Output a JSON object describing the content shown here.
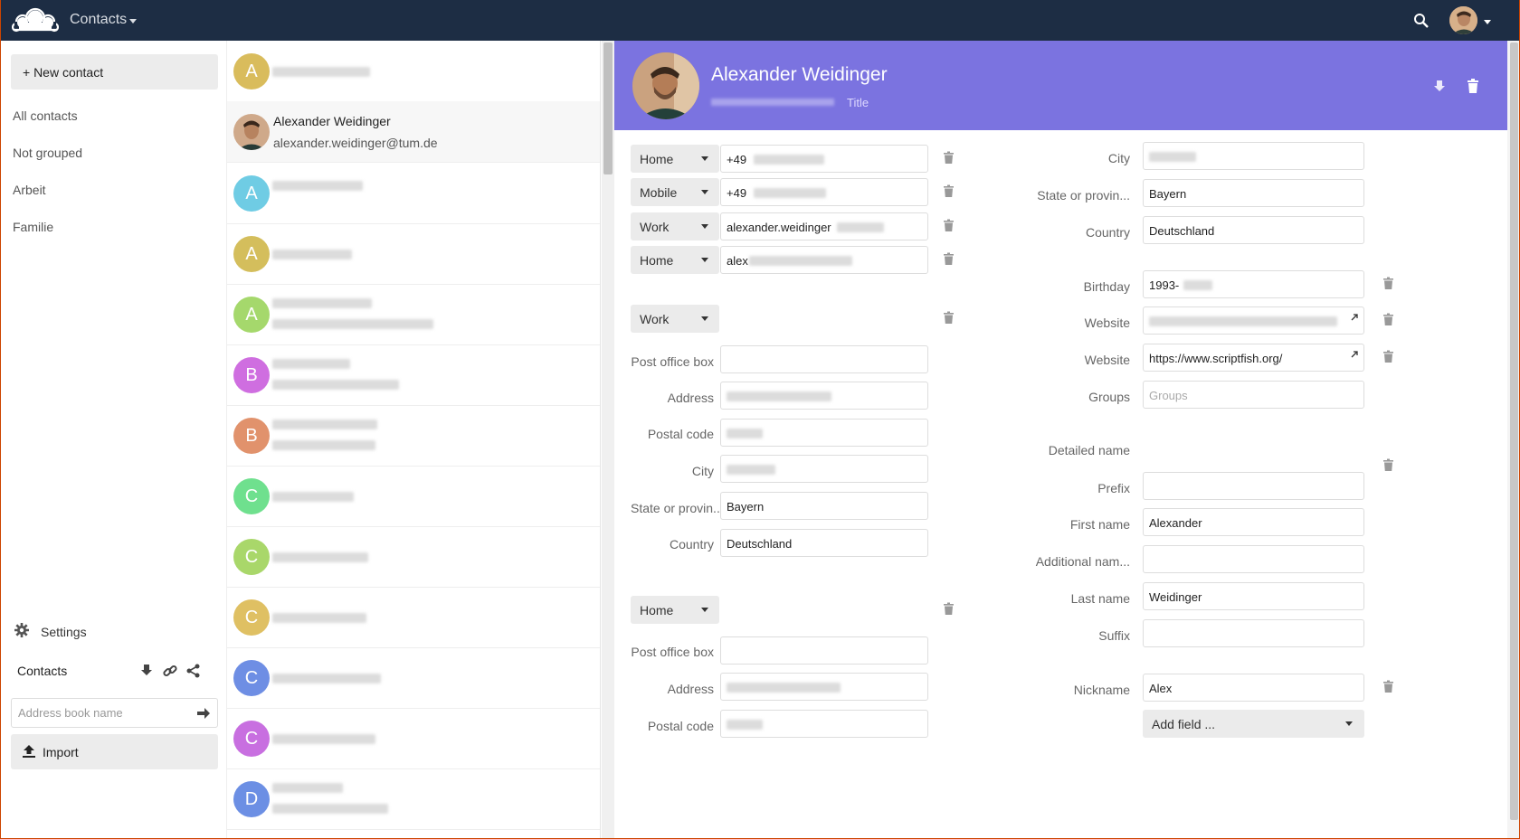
{
  "header": {
    "app_name": "Contacts",
    "search_icon": "search-icon",
    "logo": "owncloud-logo"
  },
  "sidebar": {
    "new_contact": "+ New contact",
    "nav": [
      "All contacts",
      "Not grouped",
      "Arbeit",
      "Familie"
    ],
    "settings": "Settings",
    "addressbook_label": "Contacts",
    "addressbook_placeholder": "Address book name",
    "import": "Import"
  },
  "list": {
    "rows": [
      {
        "initial": "A",
        "color": "#d9bc5c"
      },
      {
        "name": "Alexander Weidinger",
        "email": "alexander.weidinger@tum.de",
        "selected": true
      },
      {
        "initial": "A",
        "color": "#6fcce4"
      },
      {
        "initial": "A",
        "color": "#d4be5c"
      },
      {
        "initial": "A",
        "color": "#a5d86c"
      },
      {
        "initial": "B",
        "color": "#cf6ee0"
      },
      {
        "initial": "B",
        "color": "#e1926c"
      },
      {
        "initial": "C",
        "color": "#6fe08e"
      },
      {
        "initial": "C",
        "color": "#a9d76a"
      },
      {
        "initial": "C",
        "color": "#dfc063"
      },
      {
        "initial": "C",
        "color": "#6e8ee4"
      },
      {
        "initial": "C",
        "color": "#c86fe0"
      },
      {
        "initial": "D",
        "color": "#6c8fe4"
      }
    ]
  },
  "detail": {
    "name": "Alexander Weidinger",
    "title_placeholder": "Title",
    "header_color": "#7b73e0",
    "phones": [
      {
        "type": "Home",
        "value": "+49"
      },
      {
        "type": "Mobile",
        "value": "+49"
      },
      {
        "type": "Work",
        "value": "alexander.weidinger"
      },
      {
        "type": "Home",
        "value": "alex"
      }
    ],
    "address1": {
      "type": "Work",
      "labels": [
        "Post office box",
        "Address",
        "Postal code",
        "City",
        "State or provin...",
        "Country"
      ],
      "state": "Bayern",
      "country": "Deutschland"
    },
    "address2": {
      "type": "Home",
      "labels": [
        "Post office box",
        "Address",
        "Postal code"
      ]
    },
    "right": {
      "labels": {
        "city": "City",
        "state": "State or provin...",
        "country": "Country",
        "birthday": "Birthday",
        "website": "Website",
        "groups": "Groups",
        "detailed_name": "Detailed name",
        "prefix": "Prefix",
        "first_name": "First name",
        "additional": "Additional nam...",
        "last_name": "Last name",
        "suffix": "Suffix",
        "nickname": "Nickname"
      },
      "state": "Bayern",
      "country": "Deutschland",
      "birthday": "1993-",
      "website2": "https://www.scriptfish.org/",
      "groups_placeholder": "Groups",
      "first_name": "Alexander",
      "last_name": "Weidinger",
      "nickname": "Alex",
      "add_field": "Add field ..."
    }
  }
}
